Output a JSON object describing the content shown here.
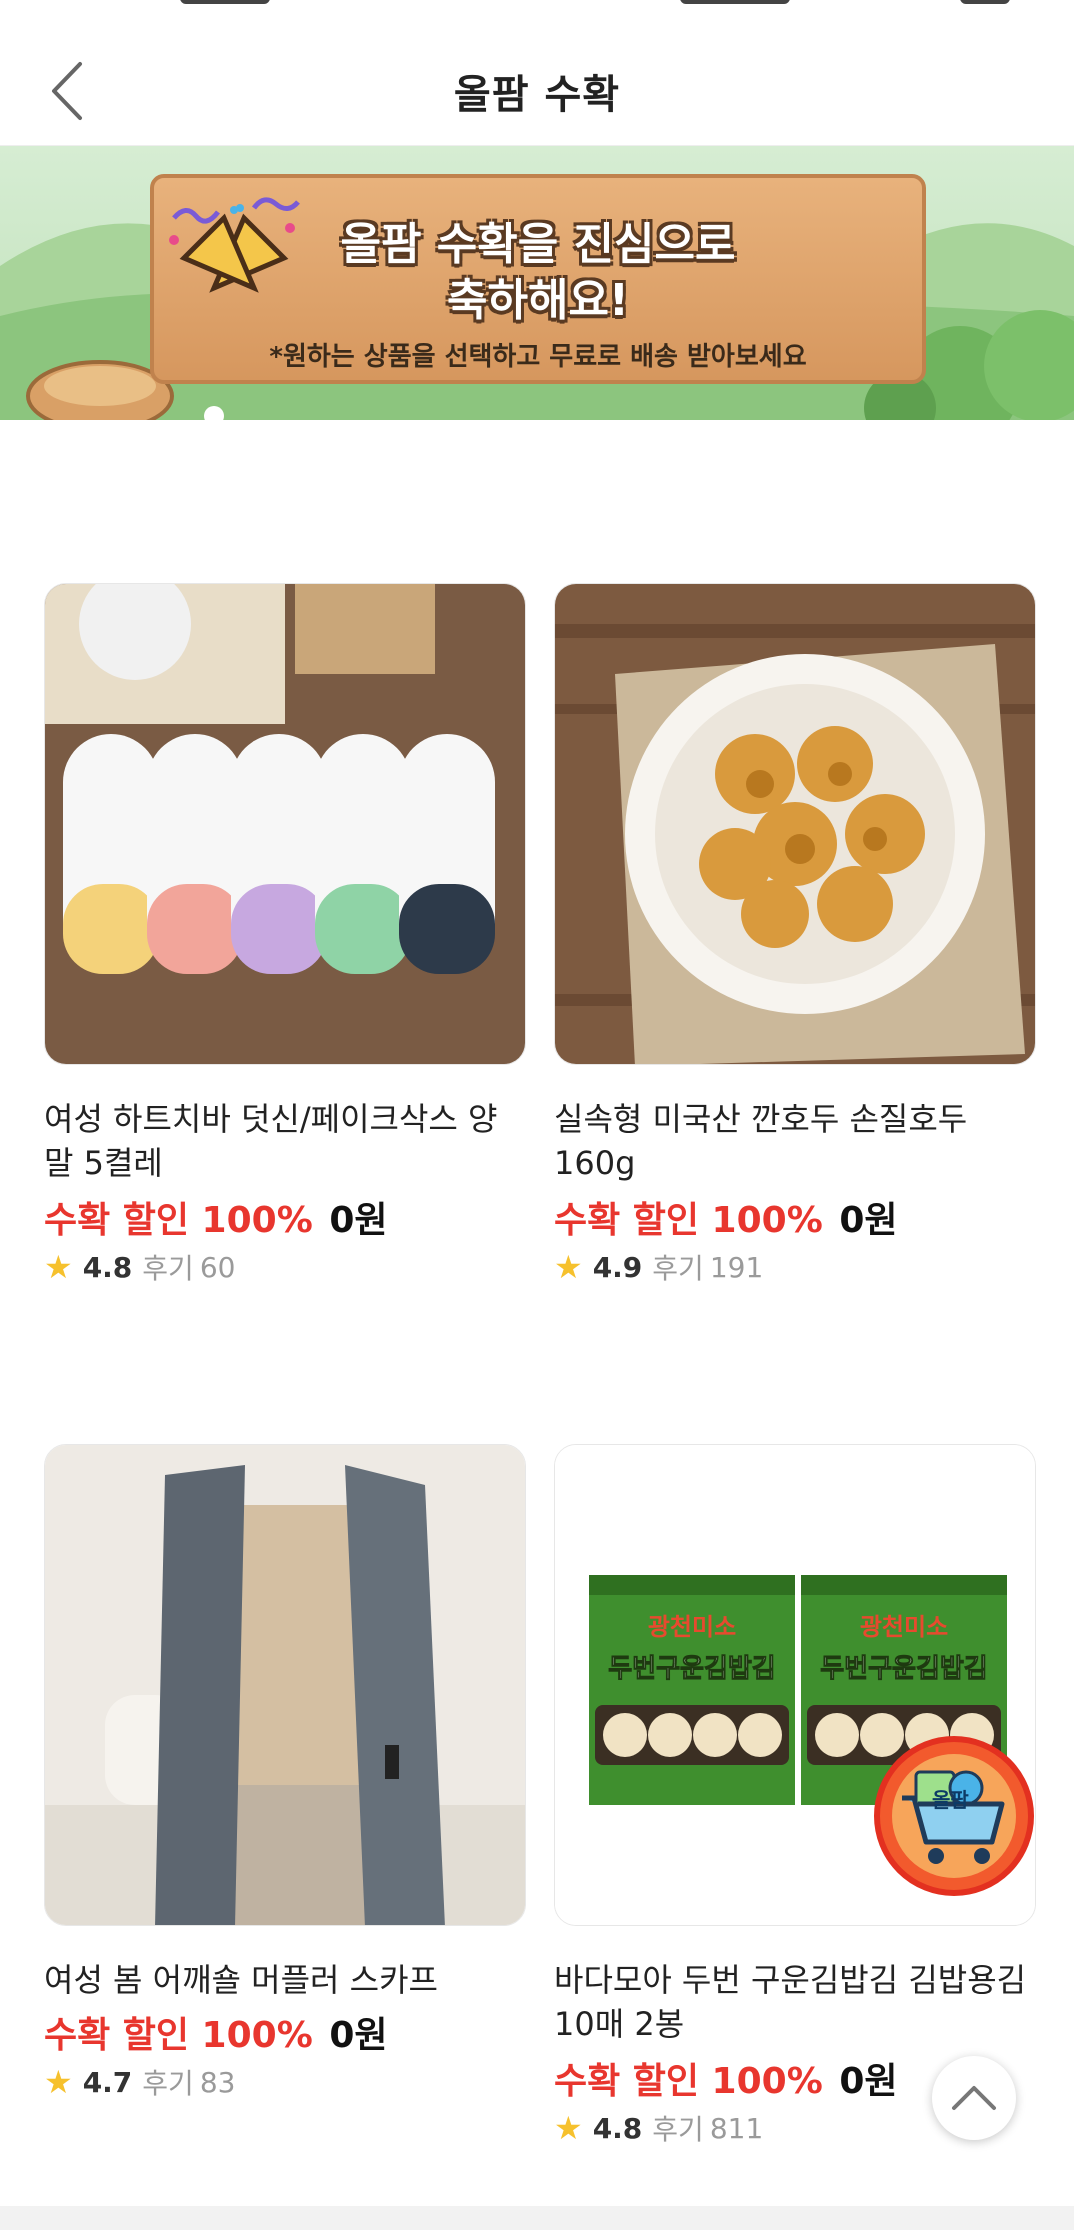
{
  "header": {
    "title": "올팜 수확",
    "back_icon": "chevron-left-icon"
  },
  "banner": {
    "headline_line1": "올팜 수확을 진심으로",
    "headline_line2": "축하해요!",
    "subtext": "*원하는 상품을 선택하고 무료로 배송 받아보세요"
  },
  "products": [
    {
      "name": "여성 하트치바 덧신/페이크삭스 양말 5켤레",
      "discount_label": "수확 할인 100%",
      "price": "0원",
      "rating": "4.8",
      "review_label": "후기",
      "review_count": "60"
    },
    {
      "name": "실속형 미국산 깐호두 손질호두 160g",
      "discount_label": "수확 할인 100%",
      "price": "0원",
      "rating": "4.9",
      "review_label": "후기",
      "review_count": "191"
    },
    {
      "name": "여성 봄 어깨숄 머플러 스카프",
      "discount_label": "수확 할인 100%",
      "price": "0원",
      "rating": "4.7",
      "review_label": "후기",
      "review_count": "83"
    },
    {
      "name": "바다모아 두번 구운김밥김 김밥용김 10매 2봉",
      "discount_label": "수확 할인 100%",
      "price": "0원",
      "rating": "4.8",
      "review_label": "후기",
      "review_count": "811"
    }
  ],
  "product_image_text": {
    "seaweed_brand": "광천미소",
    "seaweed_title": "두번구운김밥김"
  },
  "cart_fab": {
    "label": "올팜",
    "icon": "shopping-cart-icon"
  },
  "scroll_top": {
    "icon": "chevron-up-icon"
  },
  "colors": {
    "discount_red": "#e8362e",
    "star_yellow": "#f6c12d",
    "cart_orange": "#f25a2d"
  }
}
